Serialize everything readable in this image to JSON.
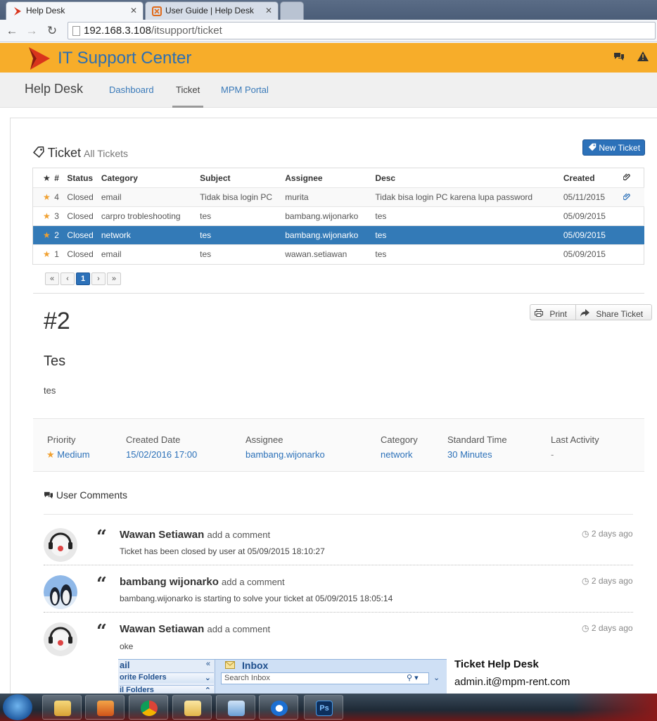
{
  "browser": {
    "tabs": [
      {
        "title": "Help Desk",
        "active": true
      },
      {
        "title": "User Guide | Help Desk",
        "active": false
      }
    ],
    "url_host": "192.168.3.108",
    "url_path": "/itsupport/ticket"
  },
  "header": {
    "brand": "IT Support Center",
    "colors": {
      "brand_bar": "#f7ad2a",
      "accent": "#2c71b9",
      "selected_row": "#337ab7"
    }
  },
  "nav": {
    "title": "Help Desk",
    "links": [
      "Dashboard",
      "Ticket",
      "MPM Portal"
    ],
    "active": "Ticket"
  },
  "ticket_list": {
    "title": "Ticket",
    "subtitle": "All Tickets",
    "new_button": "New Ticket",
    "columns": [
      "#",
      "Status",
      "Category",
      "Subject",
      "Assignee",
      "Desc",
      "Created"
    ],
    "rows": [
      {
        "num": "4",
        "status": "Closed",
        "category": "email",
        "subject": "Tidak bisa login PC",
        "assignee": "murita",
        "desc": "Tidak bisa login PC karena lupa password",
        "created": "05/11/2015",
        "attachment": true
      },
      {
        "num": "3",
        "status": "Closed",
        "category": "carpro trobleshooting",
        "subject": "tes",
        "assignee": "bambang.wijonarko",
        "desc": "tes",
        "created": "05/09/2015",
        "attachment": false
      },
      {
        "num": "2",
        "status": "Closed",
        "category": "network",
        "subject": "tes",
        "assignee": "bambang.wijonarko",
        "desc": "tes",
        "created": "05/09/2015",
        "attachment": false,
        "selected": true
      },
      {
        "num": "1",
        "status": "Closed",
        "category": "email",
        "subject": "tes",
        "assignee": "wawan.setiawan",
        "desc": "tes",
        "created": "05/09/2015",
        "attachment": false
      }
    ],
    "pager": {
      "first": "«",
      "prev": "‹",
      "current": "1",
      "next": "›",
      "last": "»"
    }
  },
  "detail": {
    "number": "#2",
    "subject": "Tes",
    "description": "tes",
    "print_label": "Print",
    "share_label": "Share Ticket",
    "info": {
      "priority_label": "Priority",
      "priority": "Medium",
      "created_label": "Created Date",
      "created": "15/02/2016 17:00",
      "assignee_label": "Assignee",
      "assignee": "bambang.wijonarko",
      "category_label": "Category",
      "category": "network",
      "standard_label": "Standard Time",
      "standard": "30 Minutes",
      "last_label": "Last Activity",
      "last": "-"
    }
  },
  "comments": {
    "title": "User Comments",
    "action": "add a comment",
    "items": [
      {
        "name": "Wawan Setiawan",
        "text": "Ticket has been closed by user at 05/09/2015 18:10:27",
        "time": "2 days ago"
      },
      {
        "name": "bambang wijonarko",
        "text": "bambang.wijonarko is starting to solve your ticket at 05/09/2015 18:05:14",
        "time": "2 days ago"
      },
      {
        "name": "Wawan Setiawan",
        "text": "oke",
        "time": "2 days ago"
      }
    ]
  },
  "embedded": {
    "left_title": "ail",
    "left_rows": [
      "orite Folders",
      "il Folders"
    ],
    "inbox_title": "Inbox",
    "search_placeholder": "Search Inbox",
    "signature_title": "Ticket Help Desk",
    "signature_email": "admin.it@mpm-rent.com"
  }
}
